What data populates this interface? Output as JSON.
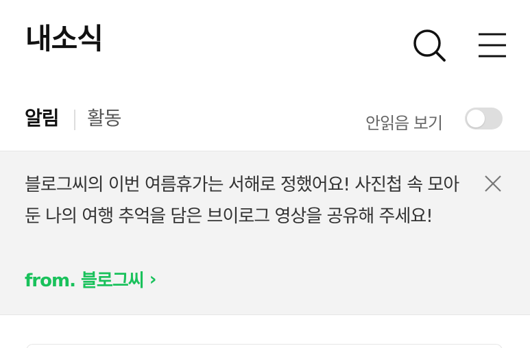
{
  "header": {
    "title": "내소식",
    "search_icon": "search-icon",
    "menu_icon": "hamburger-menu-icon"
  },
  "tabs": {
    "items": [
      {
        "label": "알림",
        "active": true
      },
      {
        "label": "활동",
        "active": false
      }
    ],
    "unread_only_label": "안읽음 보기",
    "unread_only_enabled": false
  },
  "notice": {
    "message": "블로그씨의 이번 여름휴가는 서해로 정했어요! 사진첩 속 모아둔 나의 여행 추억을 담은 브이로그 영상을 공유해 주세요!",
    "from_label": "from. 블로그씨",
    "from_arrow": "›",
    "close_icon": "close-icon",
    "accent_color": "#19c15b"
  }
}
